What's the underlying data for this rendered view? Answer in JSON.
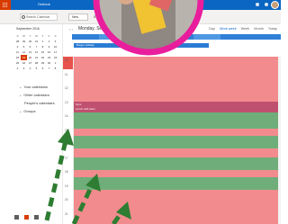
{
  "app": {
    "name": "Outlook",
    "brand_color": "#0a66c2",
    "accent_color": "#d83b01"
  },
  "topbar": {
    "icons": [
      "waffle-icon",
      "settings-icon",
      "help-icon",
      "avatar"
    ]
  },
  "commandbar": {
    "search_placeholder": "Search Calendar",
    "new_label": "New",
    "share_label": "Share"
  },
  "sidebar": {
    "month_title": "September 2016",
    "weekday_headers": [
      "S",
      "M",
      "T",
      "W",
      "T",
      "F",
      "S"
    ],
    "weeks": [
      [
        "28",
        "29",
        "30",
        "31",
        "1",
        "2",
        "3"
      ],
      [
        "4",
        "5",
        "6",
        "7",
        "8",
        "9",
        "10"
      ],
      [
        "11",
        "12",
        "13",
        "14",
        "15",
        "16",
        "17"
      ],
      [
        "18",
        "19",
        "20",
        "21",
        "22",
        "23",
        "24"
      ],
      [
        "25",
        "26",
        "27",
        "28",
        "29",
        "30",
        "1"
      ],
      [
        "2",
        "3",
        "4",
        "5",
        "6",
        "7",
        "8"
      ]
    ],
    "groups": [
      {
        "label": "Your calendars"
      },
      {
        "label": "Other calendars"
      },
      {
        "label": "People's calendars"
      },
      {
        "label": "Groups"
      }
    ]
  },
  "calendar": {
    "date_title": "Monday, Septem",
    "views": [
      "Day",
      "Work week",
      "Week",
      "Month",
      "Today"
    ],
    "allday_event": "Burger Holiday",
    "hours": [
      "10",
      "11",
      "12",
      "13",
      "14",
      "15",
      "16",
      "17",
      "18",
      "19",
      "20",
      "21"
    ],
    "event_label": "Gym",
    "event_sub": "Lunch with team"
  },
  "overlay": {
    "ring_color": "#e91e9c",
    "arrow_color": "#2e7d32"
  }
}
